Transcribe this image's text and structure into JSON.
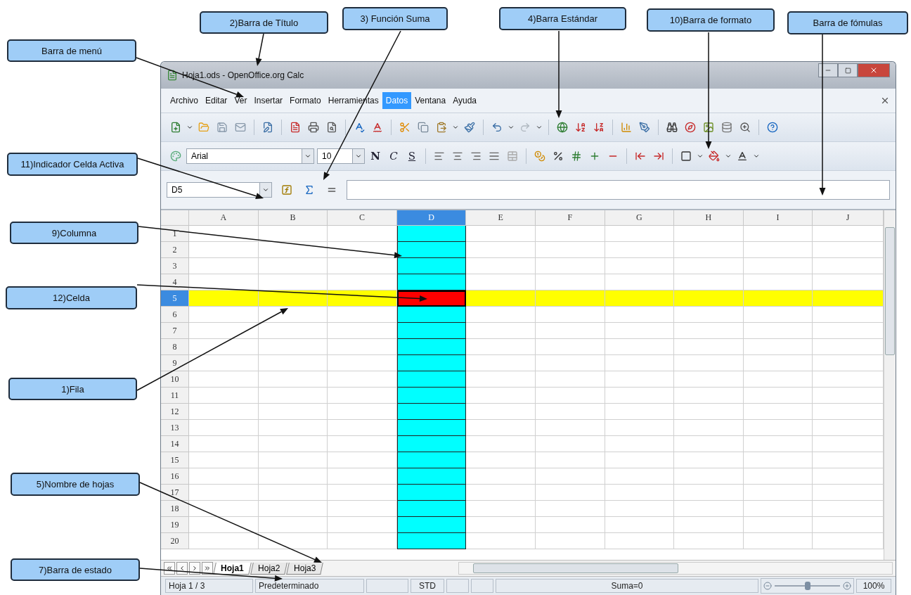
{
  "callouts": [
    {
      "text": "2)Barra de Título"
    },
    {
      "text": "3) Función Suma"
    },
    {
      "text": "4)Barra Estándar"
    },
    {
      "text": "10)Barra de formato"
    },
    {
      "text": "Barra de fómulas"
    },
    {
      "text": "Barra de menú"
    },
    {
      "text": "11)Indicador Celda Activa"
    },
    {
      "text": "9)Columna"
    },
    {
      "text": "12)Celda"
    },
    {
      "text": "1)Fila"
    },
    {
      "text": "5)Nombre de hojas"
    },
    {
      "text": "7)Barra de estado"
    }
  ],
  "window": {
    "title": "Hoja1.ods - OpenOffice.org Calc"
  },
  "menu": [
    {
      "label": "Archivo",
      "selected": false
    },
    {
      "label": "Editar",
      "selected": false
    },
    {
      "label": "Ver",
      "selected": false
    },
    {
      "label": "Insertar",
      "selected": false
    },
    {
      "label": "Formato",
      "selected": false
    },
    {
      "label": "Herramientas",
      "selected": false
    },
    {
      "label": "Datos",
      "selected": true
    },
    {
      "label": "Ventana",
      "selected": false
    },
    {
      "label": "Ayuda",
      "selected": false
    }
  ],
  "format_toolbar": {
    "font": "Arial",
    "size": "10",
    "style_buttons": [
      "N",
      "C",
      "S"
    ]
  },
  "formula_bar": {
    "name_box": "D5"
  },
  "grid": {
    "columns": [
      {
        "label": "A",
        "selected": false
      },
      {
        "label": "B",
        "selected": false
      },
      {
        "label": "C",
        "selected": false
      },
      {
        "label": "D",
        "selected": true
      },
      {
        "label": "E",
        "selected": false
      },
      {
        "label": "F",
        "selected": false
      },
      {
        "label": "G",
        "selected": false
      },
      {
        "label": "H",
        "selected": false
      },
      {
        "label": "I",
        "selected": false
      },
      {
        "label": "J",
        "selected": false
      }
    ],
    "rows": [
      {
        "label": "1",
        "selected": false
      },
      {
        "label": "2",
        "selected": false
      },
      {
        "label": "3",
        "selected": false
      },
      {
        "label": "4",
        "selected": false
      },
      {
        "label": "5",
        "selected": true
      },
      {
        "label": "6",
        "selected": false
      },
      {
        "label": "7",
        "selected": false
      },
      {
        "label": "8",
        "selected": false
      },
      {
        "label": "9",
        "selected": false
      },
      {
        "label": "10",
        "selected": false
      },
      {
        "label": "11",
        "selected": false
      },
      {
        "label": "12",
        "selected": false
      },
      {
        "label": "13",
        "selected": false
      },
      {
        "label": "14",
        "selected": false
      },
      {
        "label": "15",
        "selected": false
      },
      {
        "label": "16",
        "selected": false
      },
      {
        "label": "17",
        "selected": false
      },
      {
        "label": "18",
        "selected": false
      },
      {
        "label": "19",
        "selected": false
      },
      {
        "label": "20",
        "selected": false
      }
    ]
  },
  "sheet_tabs": [
    {
      "label": "Hoja1",
      "selected": true
    },
    {
      "label": "Hoja2",
      "selected": false
    },
    {
      "label": "Hoja3",
      "selected": false
    }
  ],
  "status_bar": {
    "sheet": "Hoja 1 / 3",
    "style": "Predeterminado",
    "mode": "STD",
    "sum": "Suma=0",
    "zoom": {
      "level": 0.5,
      "reading": "100%"
    }
  }
}
